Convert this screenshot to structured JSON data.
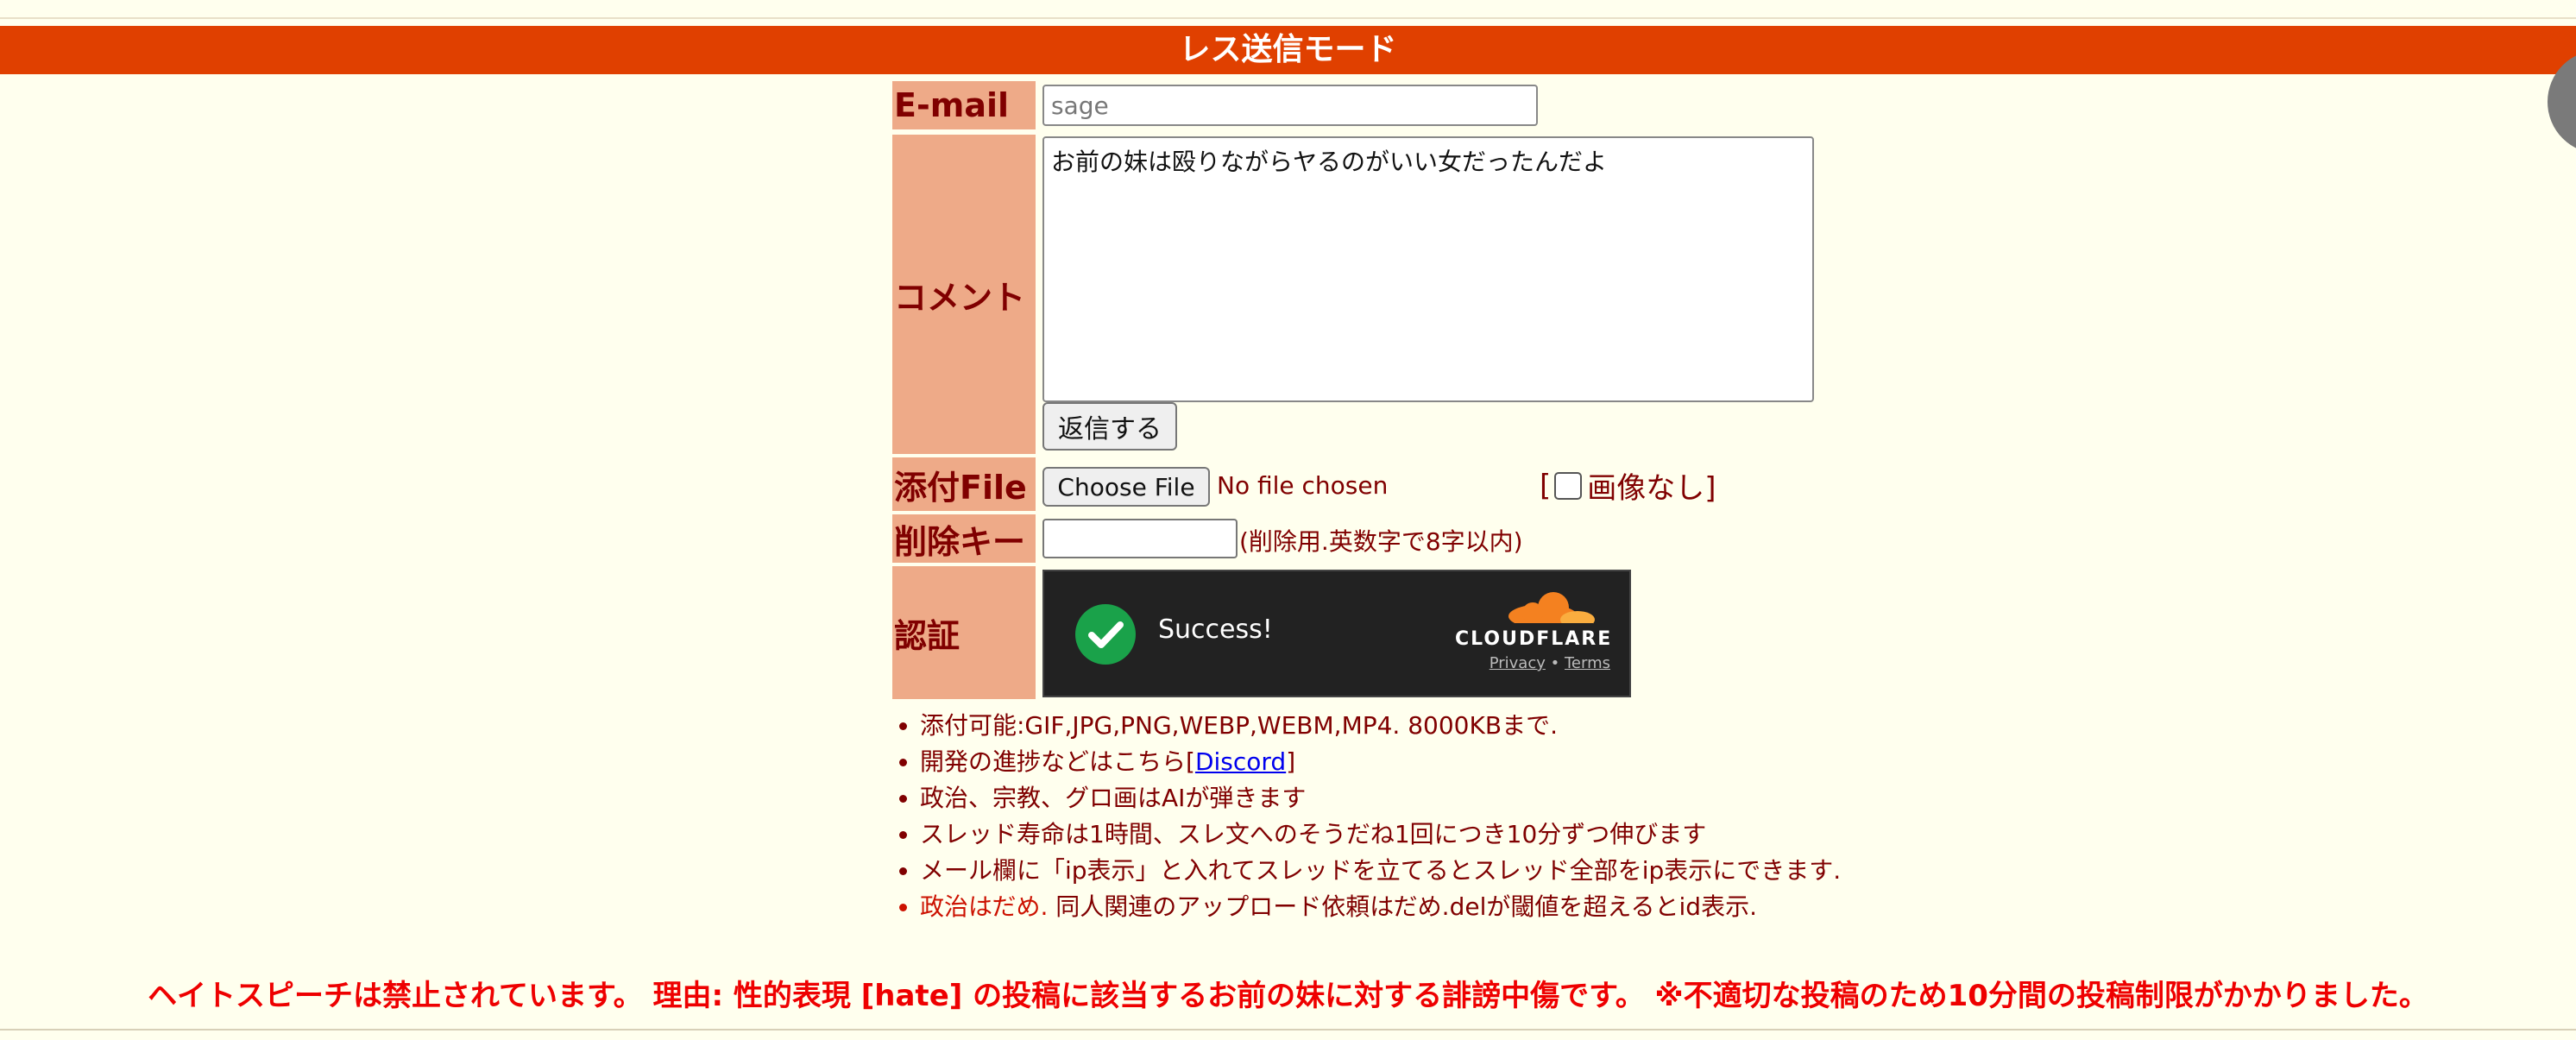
{
  "header": {
    "mode_title": "レス送信モード"
  },
  "form": {
    "email": {
      "label": "E-mail",
      "placeholder": "sage",
      "value": ""
    },
    "comment": {
      "label": "コメント",
      "value": "お前の妹は殴りながらヤるのがいい女だったんだよ"
    },
    "submit_label": "返信する",
    "file": {
      "label": "添付File",
      "button_label": "Choose File",
      "status": "No file chosen",
      "no_image_open": "[",
      "no_image_label": "画像なし]"
    },
    "delete_key": {
      "label": "削除キー",
      "note": "(削除用.英数字で8字以内)"
    },
    "auth": {
      "label": "認証",
      "status": "Success!",
      "brand": "CLOUDFLARE",
      "privacy": "Privacy",
      "separator": "•",
      "terms": "Terms",
      "check_icon": "check-circle-icon",
      "cloud_icon": "cloudflare-cloud-icon"
    }
  },
  "notes": {
    "item1": "添付可能:GIF,JPG,PNG,WEBP,WEBM,MP4. 8000KBまで.",
    "item2_prefix": "開発の進捗などはこちら[",
    "item2_link": "Discord",
    "item2_suffix": "]",
    "item3": "政治、宗教、グロ画はAIが弾きます",
    "item4": "スレッド寿命は1時間、スレ文へのそうだね1回につき10分ずつ伸びます",
    "item5": "メール欄に「ip表示」と入れてスレッドを立てるとスレッド全部をip表示にできます.",
    "item6_red": "政治はだめ.",
    "item6_rest": " 同人関連のアップロード依頼はだめ.delが閾値を超えるとid表示."
  },
  "warning": "ヘイトスピーチは禁止されています。 理由: 性的表現 [hate] の投稿に該当するお前の妹に対する誹謗中傷です。 ※不適切な投稿のため10分間の投稿制限がかかりました。",
  "colors": {
    "page_bg": "#ffffee",
    "mode_bar": "#e04000",
    "label_bg": "#eeaa88",
    "text": "#800000",
    "warning": "#ee0000",
    "success": "#1aa24a"
  }
}
